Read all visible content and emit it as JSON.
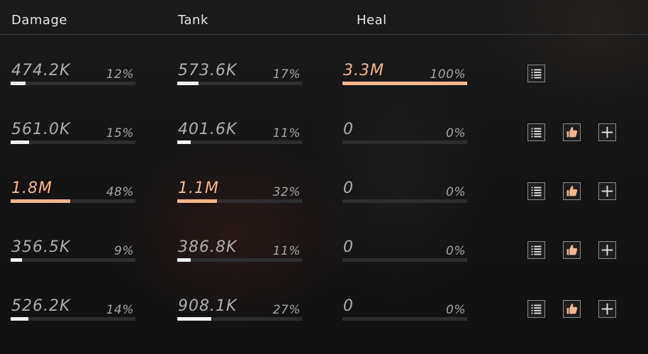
{
  "header": {
    "damage": "Damage",
    "tank": "Tank",
    "heal": "Heal"
  },
  "colors": {
    "highlight": "#f7b68c",
    "bar_fill": "#f2f2f2",
    "bar_track": "#2e2e30"
  },
  "rows": [
    {
      "damage": {
        "value": "474.2K",
        "pct": "12%",
        "fraction": 0.12,
        "highlight": false
      },
      "tank": {
        "value": "573.6K",
        "pct": "17%",
        "fraction": 0.17,
        "highlight": false
      },
      "heal": {
        "value": "3.3M",
        "pct": "100%",
        "fraction": 1.0,
        "highlight": true
      },
      "icons": [
        "list-icon"
      ]
    },
    {
      "damage": {
        "value": "561.0K",
        "pct": "15%",
        "fraction": 0.15,
        "highlight": false
      },
      "tank": {
        "value": "401.6K",
        "pct": "11%",
        "fraction": 0.11,
        "highlight": false
      },
      "heal": {
        "value": "0",
        "pct": "0%",
        "fraction": 0.0,
        "highlight": false
      },
      "icons": [
        "list-icon",
        "thumbs-up-icon",
        "plus-icon"
      ]
    },
    {
      "damage": {
        "value": "1.8M",
        "pct": "48%",
        "fraction": 0.48,
        "highlight": true
      },
      "tank": {
        "value": "1.1M",
        "pct": "32%",
        "fraction": 0.32,
        "highlight": true
      },
      "heal": {
        "value": "0",
        "pct": "0%",
        "fraction": 0.0,
        "highlight": false
      },
      "icons": [
        "list-icon",
        "thumbs-up-icon",
        "plus-icon"
      ]
    },
    {
      "damage": {
        "value": "356.5K",
        "pct": "9%",
        "fraction": 0.09,
        "highlight": false
      },
      "tank": {
        "value": "386.8K",
        "pct": "11%",
        "fraction": 0.11,
        "highlight": false
      },
      "heal": {
        "value": "0",
        "pct": "0%",
        "fraction": 0.0,
        "highlight": false
      },
      "icons": [
        "list-icon",
        "thumbs-up-icon",
        "plus-icon"
      ]
    },
    {
      "damage": {
        "value": "526.2K",
        "pct": "14%",
        "fraction": 0.14,
        "highlight": false
      },
      "tank": {
        "value": "908.1K",
        "pct": "27%",
        "fraction": 0.27,
        "highlight": false
      },
      "heal": {
        "value": "0",
        "pct": "0%",
        "fraction": 0.0,
        "highlight": false
      },
      "icons": [
        "list-icon",
        "thumbs-up-icon",
        "plus-icon"
      ]
    }
  ]
}
